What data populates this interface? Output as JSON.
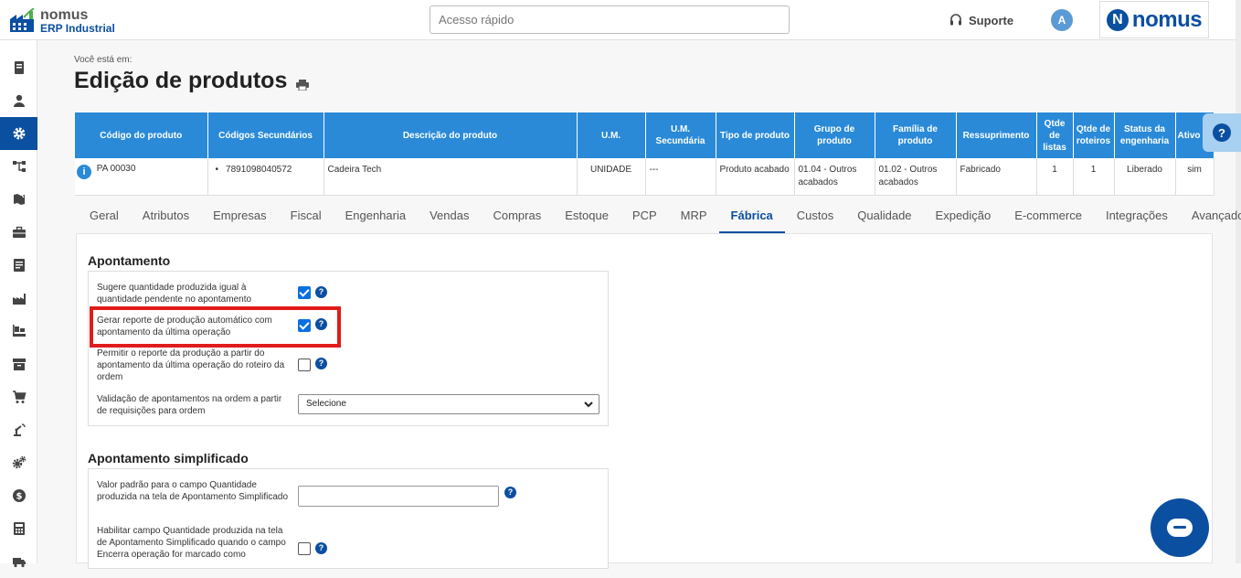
{
  "header": {
    "logo_line1": "nomus",
    "logo_line2": "ERP Industrial",
    "search_placeholder": "Acesso rápido",
    "support_label": "Suporte",
    "avatar_initial": "A",
    "brand_text": "nomus",
    "brand_letter": "N"
  },
  "sidebar": {
    "items": [
      {
        "icon": "book-icon"
      },
      {
        "icon": "user-icon"
      },
      {
        "icon": "gear-icon",
        "active": true
      },
      {
        "icon": "flow-icon"
      },
      {
        "icon": "map-icon"
      },
      {
        "icon": "briefcase-icon"
      },
      {
        "icon": "document-icon"
      },
      {
        "icon": "factory-icon"
      },
      {
        "icon": "pallet-icon"
      },
      {
        "icon": "archive-icon"
      },
      {
        "icon": "cart-icon"
      },
      {
        "icon": "robot-arm-icon"
      },
      {
        "icon": "gears-icon"
      },
      {
        "icon": "dollar-icon"
      },
      {
        "icon": "calculator-icon"
      },
      {
        "icon": "truck-icon"
      }
    ]
  },
  "page": {
    "breadcrumb": "Você está em:",
    "title": "Edição de produtos"
  },
  "product_table": {
    "headers": [
      "Código do produto",
      "Códigos Secundários",
      "Descrição do produto",
      "U.M.",
      "U.M. Secundária",
      "Tipo de produto",
      "Grupo de produto",
      "Família de produto",
      "Ressuprimento",
      "Qtde de listas",
      "Qtde de roteiros",
      "Status da engenharia",
      "Ativo"
    ],
    "row": {
      "codigo": "PA 00030",
      "secundario": "7891098040572",
      "descricao": "Cadeira Tech",
      "um": "UNIDADE",
      "um_sec": "---",
      "tipo": "Produto acabado",
      "grupo": "01.04 - Outros acabados",
      "familia": "01.02 - Outros acabados",
      "ressuprimento": "Fabricado",
      "listas": "1",
      "roteiros": "1",
      "status": "Liberado",
      "ativo": "sim"
    }
  },
  "tabs": [
    "Geral",
    "Atributos",
    "Empresas",
    "Fiscal",
    "Engenharia",
    "Vendas",
    "Compras",
    "Estoque",
    "PCP",
    "MRP",
    "Fábrica",
    "Custos",
    "Qualidade",
    "Expedição",
    "E-commerce",
    "Integrações",
    "Avançado"
  ],
  "active_tab": "Fábrica",
  "apontamento": {
    "title": "Apontamento",
    "row1_label": "Sugere quantidade produzida igual à quantidade pendente no apontamento",
    "row1_checked": true,
    "row2_label": "Gerar reporte de produção automático com apontamento da última operação",
    "row2_checked": true,
    "row3_label": "Permitir o reporte da produção a partir do apontamento da última operação do roteiro da ordem",
    "row3_checked": false,
    "row4_label": "Validação de apontamentos na ordem a partir de requisições para ordem",
    "row4_value": "Selecione"
  },
  "apontamento_simplificado": {
    "title": "Apontamento simplificado",
    "row1_label": "Valor padrão para o campo Quantidade produzida na tela de Apontamento Simplificado",
    "row2_label": "Habilitar campo Quantidade produzida na tela de Apontamento Simplificado quando o campo Encerra operação for marcado como"
  },
  "colors": {
    "primary": "#0b4fa0",
    "table_header": "#2a8ad8",
    "highlight": "#e01b1b"
  }
}
